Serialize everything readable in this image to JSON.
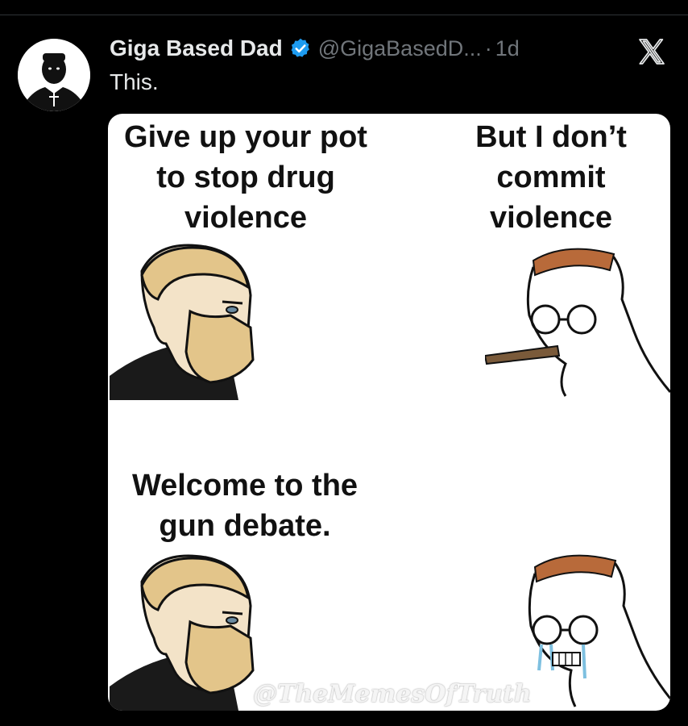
{
  "post": {
    "display_name": "Giga Based Dad",
    "handle": "@GigaBasedD...",
    "separator": "·",
    "timestamp": "1d",
    "text": "This."
  },
  "meme": {
    "panel1": "Give up your pot to stop drug violence",
    "panel2": "But I don’t commit violence",
    "panel3": "Welcome to the gun debate.",
    "watermark": "@TheMemesOfTruth"
  },
  "colors": {
    "background": "#000000",
    "verified": "#1d9bf0",
    "muted": "#71767b",
    "text": "#e7e9ea"
  },
  "icons": {
    "verified": "verified-badge-icon",
    "platform": "x-logo-icon"
  }
}
